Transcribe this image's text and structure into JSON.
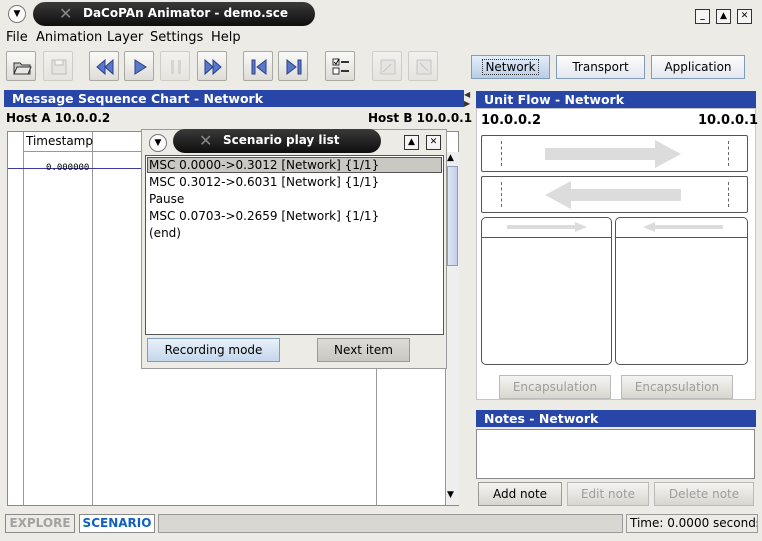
{
  "window": {
    "title": "DaCoPAn Animator - demo.sce"
  },
  "menu": [
    {
      "label": "File"
    },
    {
      "label": "Animation"
    },
    {
      "label": "Layer"
    },
    {
      "label": "Settings"
    },
    {
      "label": "Help"
    }
  ],
  "layers": {
    "network": "Network",
    "transport": "Transport",
    "application": "Application"
  },
  "msc": {
    "header": "Message Sequence Chart - Network",
    "host_a": "Host A 10.0.0.2",
    "host_b": "Host B 10.0.0.1",
    "timestamp_col": "Timestamp",
    "first_timestamp": "0.000000"
  },
  "playlist": {
    "title": "Scenario play list",
    "items": [
      "MSC 0.0000->0.3012 [Network] {1/1}",
      "MSC 0.3012->0.6031 [Network] {1/1}",
      "Pause",
      "MSC 0.0703->0.2659 [Network] {1/1}",
      "(end)"
    ],
    "recording_mode": "Recording mode",
    "next_item": "Next item"
  },
  "unit_flow": {
    "header": "Unit Flow - Network",
    "left_host": "10.0.0.2",
    "right_host": "10.0.0.1",
    "encapsulation_left": "Encapsulation",
    "encapsulation_right": "Encapsulation"
  },
  "notes": {
    "header": "Notes - Network",
    "add": "Add note",
    "edit": "Edit note",
    "delete": "Delete note"
  },
  "status": {
    "explore": "EXPLORE",
    "scenario": "SCENARIO",
    "time": "Time: 0.0000 seconds"
  },
  "colors": {
    "header_blue": "#2746a8",
    "accent": "#1060c0"
  }
}
